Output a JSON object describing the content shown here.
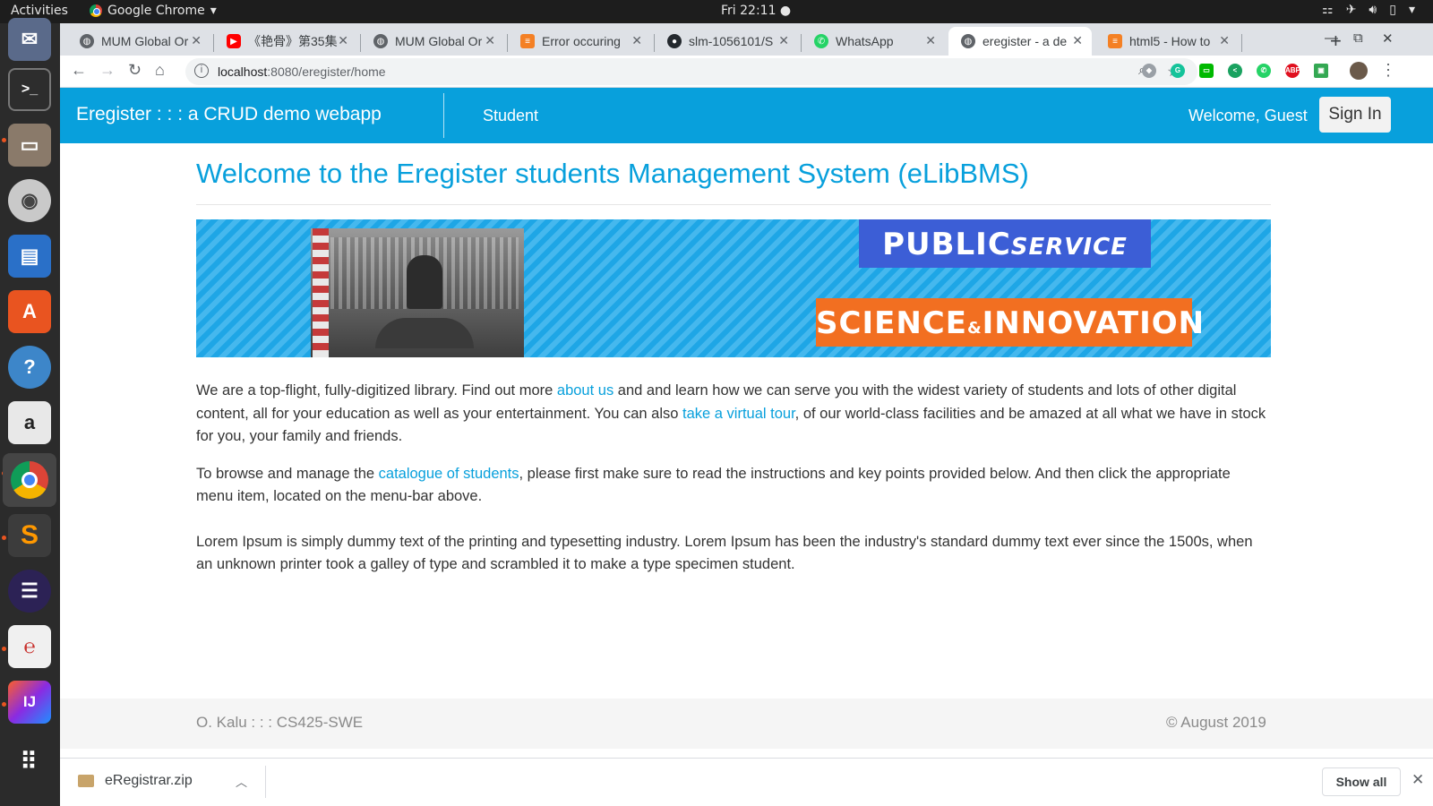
{
  "os": {
    "activities": "Activities",
    "app_name": "Google Chrome",
    "clock": "Fri 22:11"
  },
  "tabs": [
    {
      "title": "MUM Global Or",
      "icon": "globe-icon"
    },
    {
      "title": "《艳骨》第35集",
      "icon": "youtube-icon"
    },
    {
      "title": "MUM Global Or",
      "icon": "globe-icon"
    },
    {
      "title": "Error occuring",
      "icon": "stackoverflow-icon"
    },
    {
      "title": "slm-1056101/S",
      "icon": "github-icon"
    },
    {
      "title": "WhatsApp",
      "icon": "whatsapp-icon"
    },
    {
      "title": "eregister - a de",
      "icon": "globe-icon",
      "active": true
    },
    {
      "title": "html5 - How to",
      "icon": "stackoverflow-icon"
    }
  ],
  "address": {
    "host": "localhost",
    "rest": ":8080/eregister/home"
  },
  "navbar": {
    "brand": "Eregister : : : a CRUD demo webapp",
    "student": "Student",
    "welcome": "Welcome, Guest",
    "signin": "Sign In"
  },
  "content": {
    "heading": "Welcome to the Eregister students Management System (eLibBMS)",
    "banner_public": "PUBLIC",
    "banner_service": "SERVICE",
    "banner_science": "SCIENCE",
    "banner_amp": "&",
    "banner_innovation": "INNOVATION",
    "p1_a": "We are a top-flight, fully-digitized library. Find out more ",
    "p1_link1": "about us",
    "p1_b": " and and learn how we can serve you with the widest variety of students and lots of other digital content, all for your education as well as your entertainment. You can also ",
    "p1_link2": "take a virtual tour",
    "p1_c": ", of our world-class facilities and be amazed at all what we have in stock for you, your family and friends.",
    "p2_a": "To browse and manage the ",
    "p2_link": "catalogue of students",
    "p2_b": ", please first make sure to read the instructions and key points provided below. And then click the appropriate menu item, located on the menu-bar above.",
    "p3": "Lorem Ipsum is simply dummy text of the printing and typesetting industry. Lorem Ipsum has been the industry's standard dummy text ever since the 1500s, when an unknown printer took a galley of type and scrambled it to make a type specimen student."
  },
  "footer": {
    "left": "O. Kalu : : : CS425-SWE",
    "right": "© August 2019"
  },
  "downloads": {
    "file": "eRegistrar.zip",
    "show_all": "Show all"
  },
  "colors": {
    "brand": "#08a0dc",
    "banner_blue": "#3c5ed6",
    "banner_orange": "#f26f21"
  }
}
